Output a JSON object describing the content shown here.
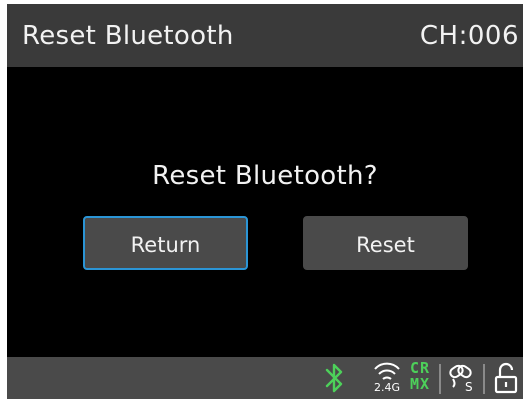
{
  "header": {
    "title": "Reset Bluetooth",
    "channel": "CH:006"
  },
  "dialog": {
    "prompt": "Reset Bluetooth?",
    "return_label": "Return",
    "reset_label": "Reset",
    "focused_button": "return"
  },
  "statusbar": {
    "bluetooth_icon": "bluetooth-icon",
    "wireless_icon": "wireless-signal-icon",
    "band_label": "2.4G",
    "protocol_top": "CR",
    "protocol_bottom": "MX",
    "link_icon": "link-chain-s-icon",
    "link_letter": "S",
    "lock_icon": "unlocked-padlock-icon"
  },
  "colors": {
    "background": "#000000",
    "bar": "#3a3a3a",
    "button": "#4a4a4a",
    "focus_border": "#2b95d6",
    "bluetooth": "#4dd05a",
    "crmx": "#4dd05a",
    "text": "#f2f2f2"
  }
}
